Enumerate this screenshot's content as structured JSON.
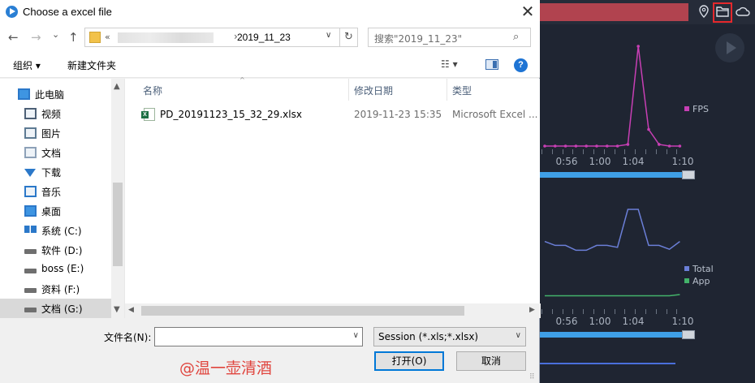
{
  "dialog": {
    "title": "Choose a excel file",
    "close_glyph": "✕",
    "nav": {
      "back_glyph": "←",
      "forward_glyph": "→",
      "recent_glyph": "⌄",
      "up_glyph": "↑",
      "address_prefix": "«",
      "address_separator": "›",
      "address_current": "2019_11_23",
      "address_dropdown_glyph": "∨",
      "refresh_glyph": "↻",
      "search_placeholder": "搜索\"2019_11_23\"",
      "search_glyph": "⌕"
    },
    "toolbar": {
      "organize": "组织 ▾",
      "new_folder": "新建文件夹",
      "view_glyph": "☷ ▾",
      "help_glyph": "?"
    },
    "sidebar": {
      "items": [
        {
          "label": "此电脑",
          "icon": "computer-icon"
        },
        {
          "label": "视频",
          "icon": "video-icon"
        },
        {
          "label": "图片",
          "icon": "picture-icon"
        },
        {
          "label": "文档",
          "icon": "document-icon"
        },
        {
          "label": "下载",
          "icon": "download-icon"
        },
        {
          "label": "音乐",
          "icon": "music-icon"
        },
        {
          "label": "桌面",
          "icon": "desktop-icon"
        },
        {
          "label": "系统 (C:)",
          "icon": "windows-drive-icon"
        },
        {
          "label": "软件 (D:)",
          "icon": "drive-icon"
        },
        {
          "label": "boss (E:)",
          "icon": "drive-icon"
        },
        {
          "label": "资料 (F:)",
          "icon": "drive-icon"
        },
        {
          "label": "文档 (G:)",
          "icon": "drive-icon"
        }
      ],
      "scroll_up_glyph": "▲",
      "scroll_down_glyph": "▼"
    },
    "columns": [
      "名称",
      "修改日期",
      "类型"
    ],
    "sort_glyph": "^",
    "files": [
      {
        "name": "PD_20191123_15_32_29.xlsx",
        "modified": "2019-11-23 15:35",
        "type": "Microsoft Excel ..."
      }
    ],
    "hscroll_left_glyph": "◀",
    "hscroll_right_glyph": "▶",
    "filename_label": "文件名(N):",
    "filename_value": "",
    "filetype_value": "Session (*.xls;*.xlsx)",
    "dropdown_glyph": "∨",
    "open_button": "打开(O)",
    "cancel_button": "取消",
    "grip_glyph": "⠿"
  },
  "watermark": "@温一壶清酒",
  "app": {
    "fps_legend": "FPS",
    "cpu_legends": [
      "Total",
      "App"
    ],
    "time_labels": [
      "0:56",
      "1:00",
      "1:04",
      "1:10"
    ],
    "colors": {
      "fps": "#c73fb4",
      "total": "#6b7fd8",
      "app": "#43b36a",
      "accent": "#3f9fe6",
      "highlight_box": "#e5282c"
    }
  },
  "chart_data": [
    {
      "type": "line",
      "series": [
        {
          "name": "FPS",
          "values": [
            0,
            0,
            0,
            0,
            0,
            0,
            0,
            0,
            1,
            60,
            10,
            1,
            0,
            0
          ]
        }
      ],
      "legend": "right"
    },
    {
      "type": "line",
      "series": [
        {
          "name": "Total",
          "values": [
            12,
            8,
            8,
            3,
            3,
            8,
            8,
            6,
            45,
            45,
            8,
            8,
            4,
            12
          ]
        },
        {
          "name": "App",
          "values": [
            1,
            1,
            1,
            1,
            1,
            1,
            1,
            1,
            1,
            1,
            1,
            1,
            1,
            2
          ]
        }
      ],
      "legend": "right"
    }
  ]
}
